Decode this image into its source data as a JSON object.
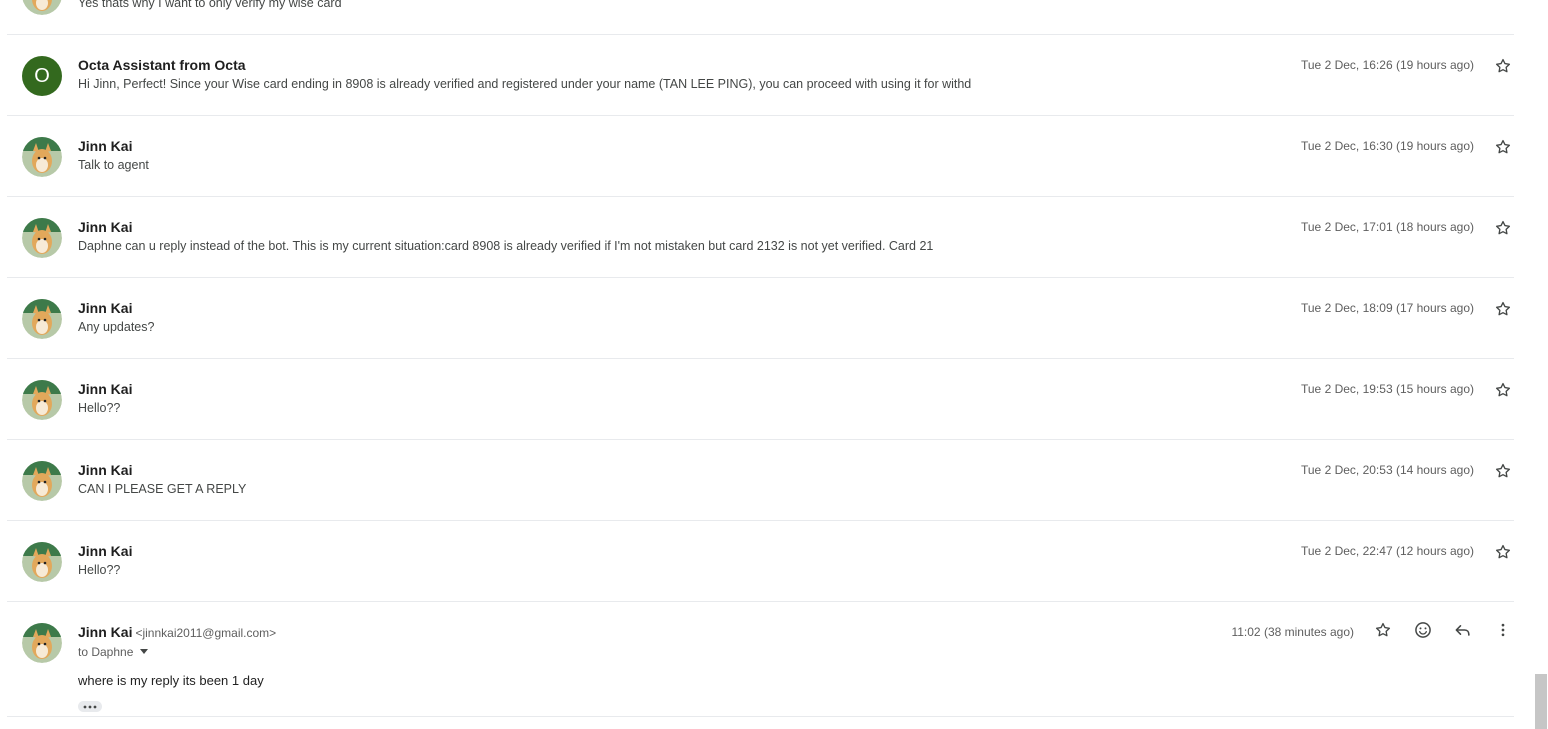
{
  "messages": [
    {
      "sender": "",
      "snippet": "Yes thats why I want to only verify my wise card",
      "time": "",
      "avatar": "corgi"
    },
    {
      "sender": "Octa Assistant from Octa",
      "snippet": "Hi Jinn, Perfect! Since your Wise card ending in 8908 is already verified and registered under your name (TAN LEE PING), you can proceed with using it for withd",
      "time": "Tue 2 Dec, 16:26 (19 hours ago)",
      "avatar": "letter",
      "avatar_letter": "O"
    },
    {
      "sender": "Jinn Kai",
      "snippet": "Talk to agent",
      "time": "Tue 2 Dec, 16:30 (19 hours ago)",
      "avatar": "corgi"
    },
    {
      "sender": "Jinn Kai",
      "snippet": "Daphne can u reply instead of the bot. This is my current situation:card 8908 is already verified if I'm not mistaken but card 2132 is not yet verified. Card 21",
      "time": "Tue 2 Dec, 17:01 (18 hours ago)",
      "avatar": "corgi"
    },
    {
      "sender": "Jinn Kai",
      "snippet": "Any updates?",
      "time": "Tue 2 Dec, 18:09 (17 hours ago)",
      "avatar": "corgi"
    },
    {
      "sender": "Jinn Kai",
      "snippet": "Hello??",
      "time": "Tue 2 Dec, 19:53 (15 hours ago)",
      "avatar": "corgi"
    },
    {
      "sender": "Jinn Kai",
      "snippet": "CAN I PLEASE GET A REPLY",
      "time": "Tue 2 Dec, 20:53 (14 hours ago)",
      "avatar": "corgi"
    },
    {
      "sender": "Jinn Kai",
      "snippet": "Hello??",
      "time": "Tue 2 Dec, 22:47 (12 hours ago)",
      "avatar": "corgi"
    }
  ],
  "expanded": {
    "sender": "Jinn Kai",
    "email": "<jinnkai2011@gmail.com>",
    "to": "to Daphne",
    "time": "11:02 (38 minutes ago)",
    "body": "where is my reply its been 1 day"
  },
  "icons": {
    "star": "star-outline-icon",
    "emoji": "emoji-reaction-icon",
    "reply": "reply-arrow-icon",
    "more": "more-vert-icon"
  },
  "colors": {
    "avatar_letter_bg": "#33691e",
    "divider": "#e8eaed"
  }
}
